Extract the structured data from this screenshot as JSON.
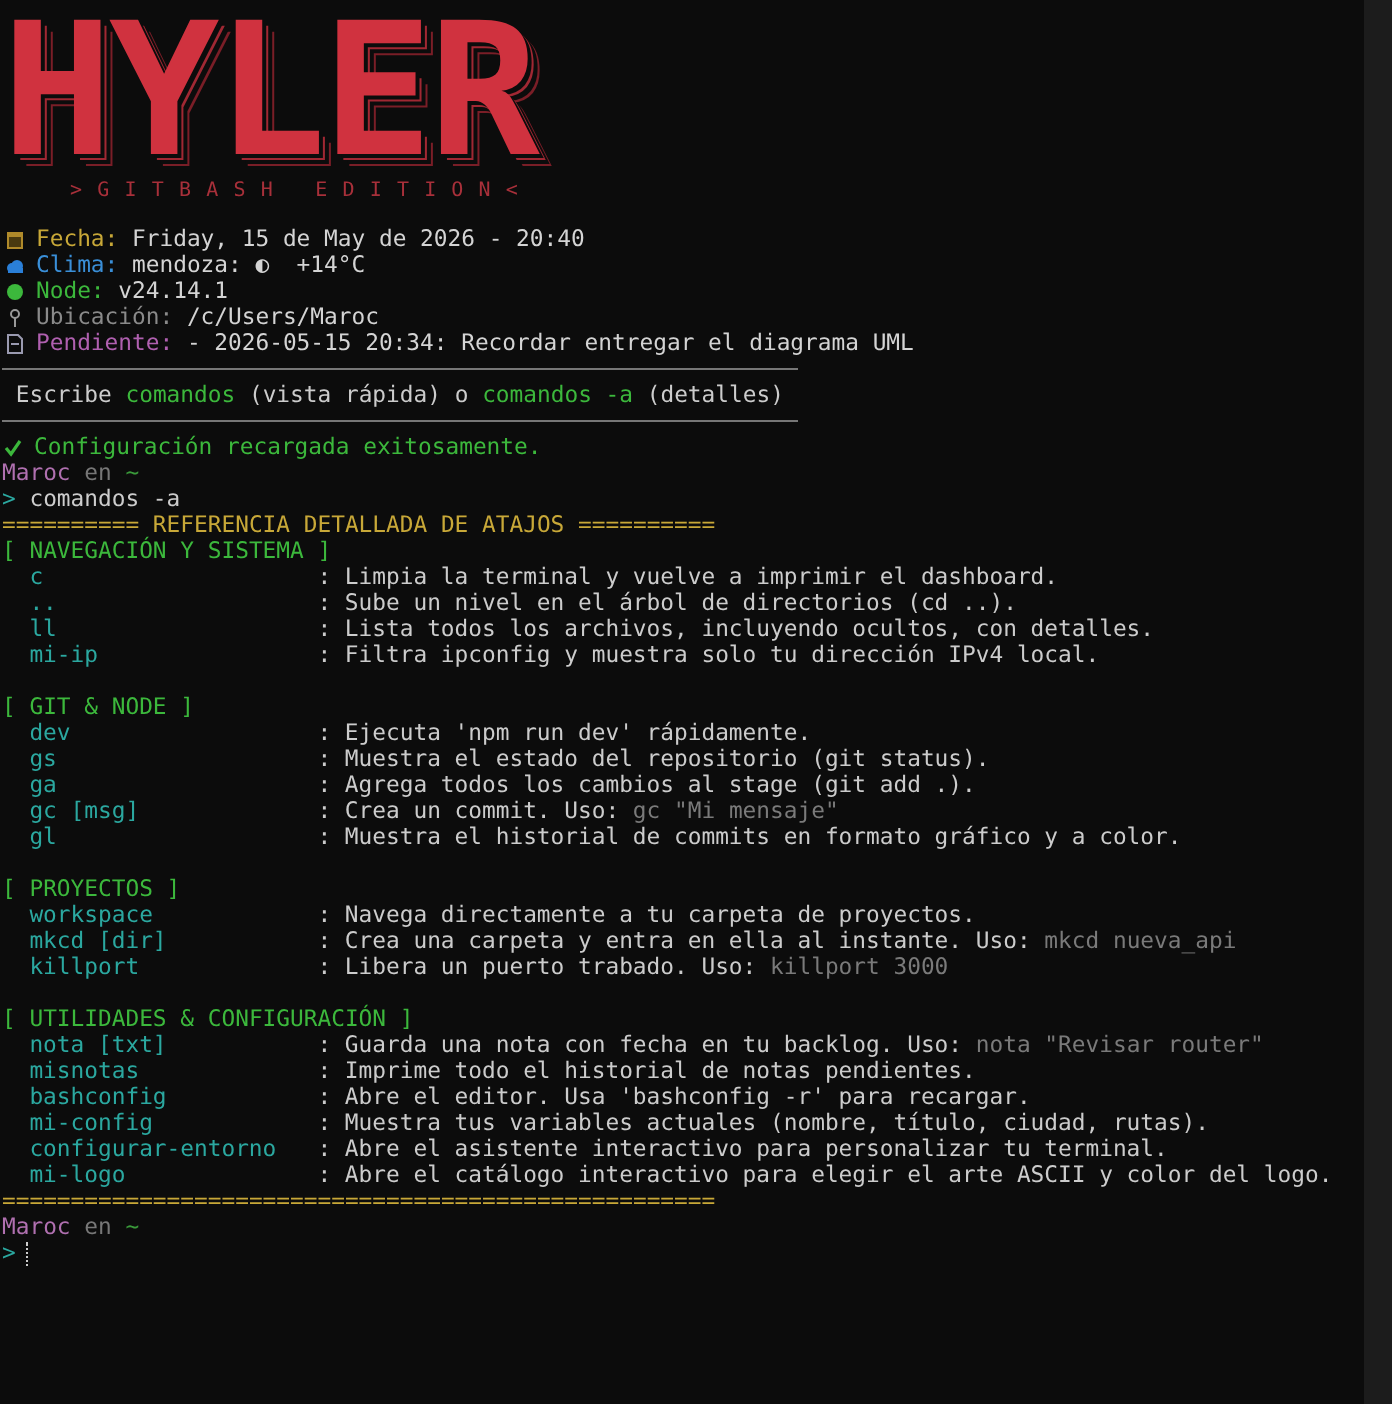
{
  "logo": {
    "title": "HYLER",
    "subtitle": ">GITBASH EDITION<"
  },
  "info": [
    {
      "kind": "calendar",
      "label": "Fecha:",
      "value": "Friday, 15 de May de 2026 - 20:40",
      "color": "#c8a838"
    },
    {
      "kind": "weather",
      "label": "Clima:",
      "value": "mendoza: ◐  +14°C",
      "color": "#3a8fd8"
    },
    {
      "kind": "node",
      "label": "Node:",
      "value": "v24.14.1",
      "color": "#3cb83c"
    },
    {
      "kind": "location",
      "label": "Ubicación:",
      "value": "/c/Users/Maroc",
      "color": "#8a8a8a"
    },
    {
      "kind": "note",
      "label": "Pendiente:",
      "value": "- 2026-05-15 20:34: Recordar entregar el diagrama UML",
      "color": "#b060b0"
    }
  ],
  "hint": [
    {
      "kind": "plain",
      "text": " Escribe "
    },
    {
      "kind": "command",
      "text": "comandos"
    },
    {
      "kind": "plain",
      "text": " (vista rápida) o "
    },
    {
      "kind": "command",
      "text": "comandos -a"
    },
    {
      "kind": "plain",
      "text": " (detalles)"
    }
  ],
  "status": {
    "kind": "success",
    "text": "Configuración recargada exitosamente."
  },
  "prompt": {
    "user": "Maroc",
    "sep": "en",
    "dir": "~",
    "symbol": ">",
    "command": "comandos -a"
  },
  "reference": {
    "header": "========== REFERENCIA DETALLADA DE ATAJOS ==========",
    "sections": [
      {
        "title": "[ NAVEGACIÓN Y SISTEMA ]",
        "items": [
          {
            "cmd": "c",
            "desc": ": Limpia la terminal y vuelve a imprimir el dashboard."
          },
          {
            "cmd": "..",
            "desc": ": Sube un nivel en el árbol de directorios (cd ..)."
          },
          {
            "cmd": "ll",
            "desc": ": Lista todos los archivos, incluyendo ocultos, con detalles."
          },
          {
            "cmd": "mi-ip",
            "desc": ": Filtra ipconfig y muestra solo tu dirección IPv4 local."
          }
        ]
      },
      {
        "title": "[ GIT & NODE ]",
        "items": [
          {
            "cmd": "dev",
            "desc": ": Ejecuta 'npm run dev' rápidamente."
          },
          {
            "cmd": "gs",
            "desc": ": Muestra el estado del repositorio (git status)."
          },
          {
            "cmd": "ga",
            "desc": ": Agrega todos los cambios al stage (git add .)."
          },
          {
            "cmd": "gc [msg]",
            "desc": ": Crea un commit. Uso:",
            "usage": "gc \"Mi mensaje\""
          },
          {
            "cmd": "gl",
            "desc": ": Muestra el historial de commits en formato gráfico y a color."
          }
        ]
      },
      {
        "title": "[ PROYECTOS ]",
        "items": [
          {
            "cmd": "workspace",
            "desc": ": Navega directamente a tu carpeta de proyectos."
          },
          {
            "cmd": "mkcd [dir]",
            "desc": ": Crea una carpeta y entra en ella al instante. Uso:",
            "usage": "mkcd nueva_api"
          },
          {
            "cmd": "killport",
            "desc": ": Libera un puerto trabado. Uso:",
            "usage": "killport 3000"
          }
        ]
      },
      {
        "title": "[ UTILIDADES & CONFIGURACIÓN ]",
        "items": [
          {
            "cmd": "nota [txt]",
            "desc": ": Guarda una nota con fecha en tu backlog. Uso:",
            "usage": "nota \"Revisar router\""
          },
          {
            "cmd": "misnotas",
            "desc": ": Imprime todo el historial de notas pendientes."
          },
          {
            "cmd": "bashconfig",
            "desc": ": Abre el editor. Usa 'bashconfig -r' para recargar."
          },
          {
            "cmd": "mi-config",
            "desc": ": Muestra tus variables actuales (nombre, título, ciudad, rutas)."
          },
          {
            "cmd": "configurar-entorno",
            "desc": ": Abre el asistente interactivo para personalizar tu terminal."
          },
          {
            "cmd": "mi-logo",
            "desc": ": Abre el catálogo interactivo para elegir el arte ASCII y color del logo."
          }
        ]
      }
    ],
    "footer": "===================================================="
  },
  "prompt2": {
    "user": "Maroc",
    "sep": "en",
    "dir": "~",
    "symbol": ">"
  }
}
